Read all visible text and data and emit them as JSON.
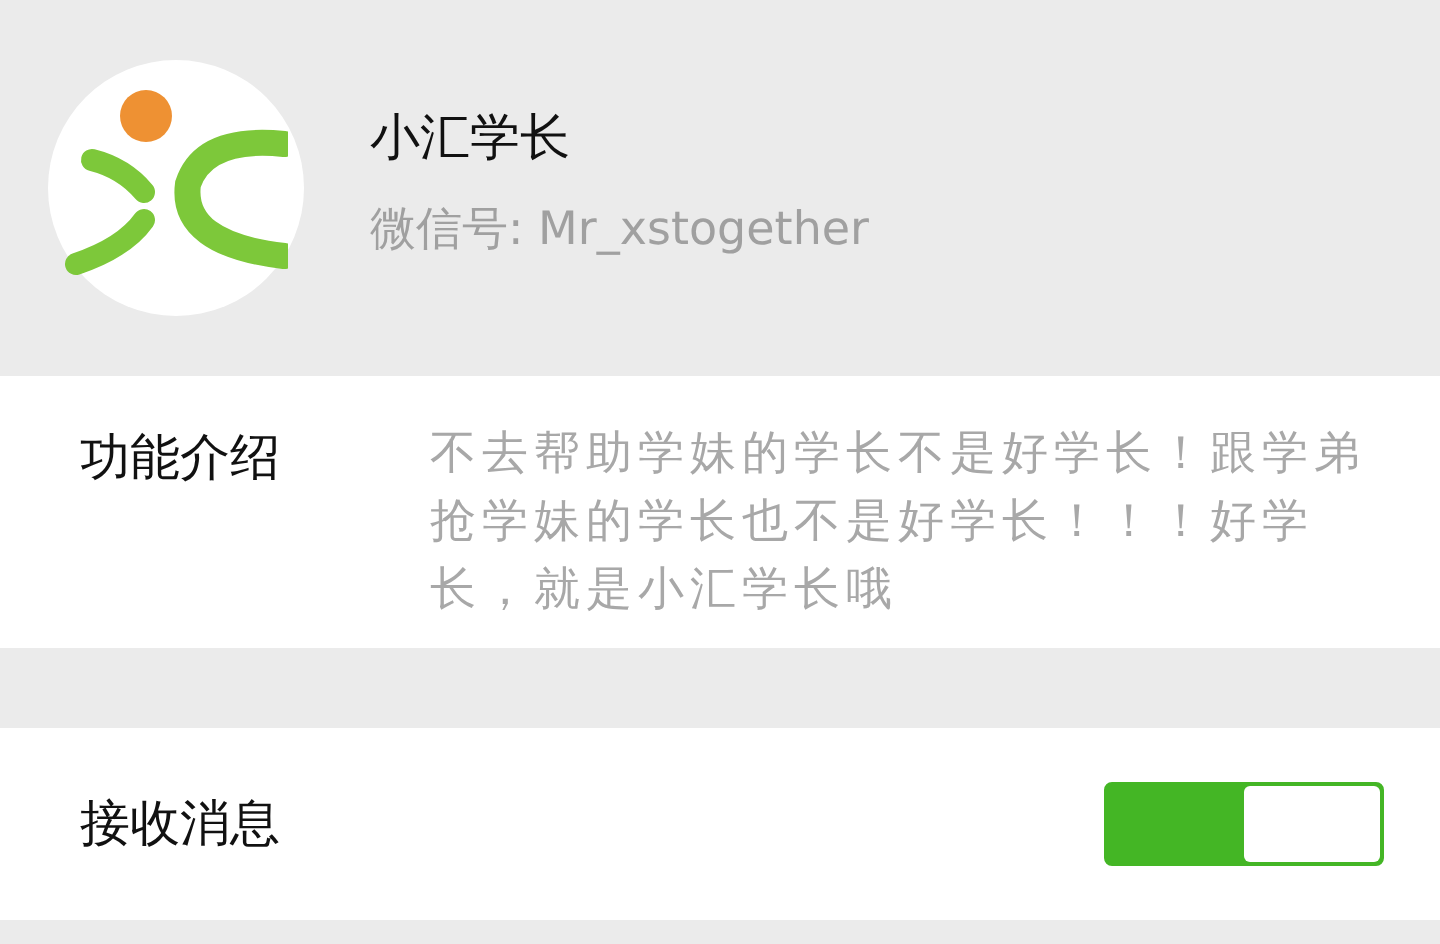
{
  "profile": {
    "name": "小汇学长",
    "wechat_id": "微信号: Mr_xstogether"
  },
  "intro": {
    "label": "功能介绍",
    "text": "不去帮助学妹的学长不是好学长！跟学弟抢学妹的学长也不是好学长！！！好学长，就是小汇学长哦"
  },
  "receive_messages": {
    "label": "接收消息",
    "on": true
  }
}
